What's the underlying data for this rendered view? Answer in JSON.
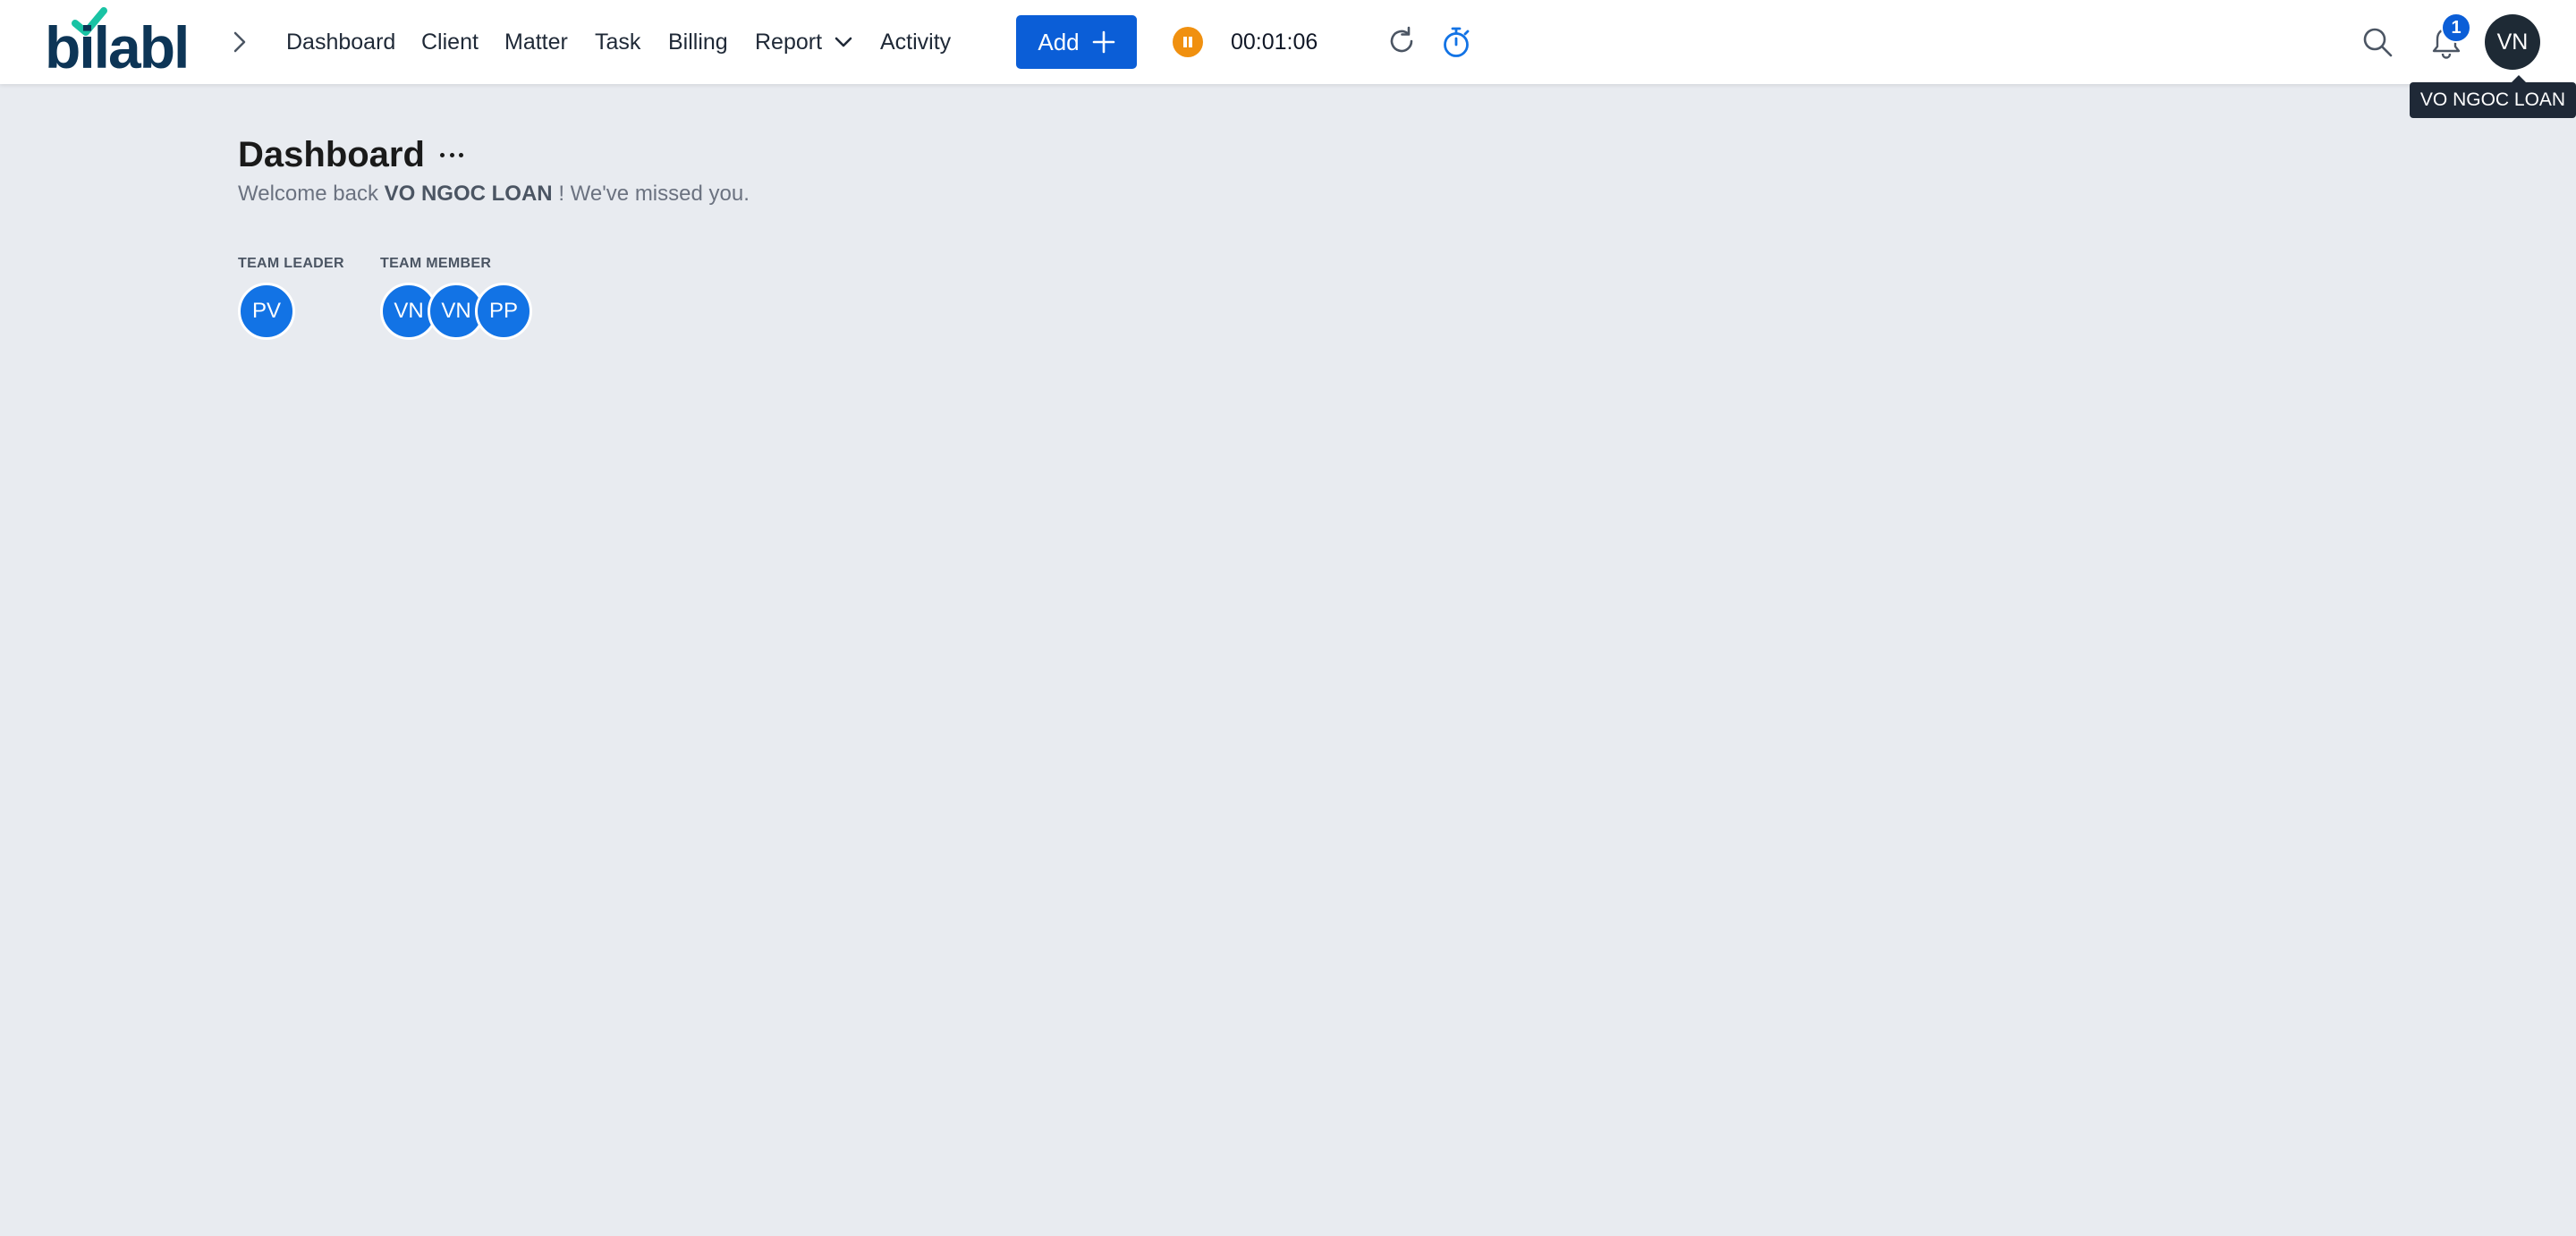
{
  "app": {
    "logo_text": "bilabl"
  },
  "nav": {
    "dashboard": "Dashboard",
    "client": "Client",
    "matter": "Matter",
    "task": "Task",
    "billing": "Billing",
    "report": "Report",
    "activity": "Activity"
  },
  "toolbar": {
    "add_label": "Add",
    "timer": "00:01:06",
    "notification_count": "1",
    "user_initials": "VN",
    "user_tooltip": "VO NGOC LOAN"
  },
  "main": {
    "title": "Dashboard",
    "welcome_prefix": "Welcome back",
    "welcome_name": "VO NGOC LOAN",
    "welcome_suffix": "! We've missed you.",
    "team_leader_label": "TEAM LEADER",
    "team_member_label": "TEAM MEMBER",
    "team_leaders": [
      "PV"
    ],
    "team_members": [
      "VN",
      "VN",
      "PP"
    ]
  },
  "colors": {
    "brand_primary": "#0b5ed7",
    "brand_dark": "#0d3556",
    "logo_check": "#19c3a4",
    "timer_pause": "#f0900f",
    "background": "#e8ebf0",
    "avatar_blue": "#1273e5"
  },
  "icons": {
    "breadcrumb": "chevron-right-icon",
    "report_dropdown": "chevron-down-icon",
    "add": "plus-icon",
    "timer": "pause-icon",
    "refresh": "refresh-icon",
    "stopwatch": "stopwatch-icon",
    "search": "search-icon",
    "notifications": "bell-icon",
    "more": "more-icon"
  }
}
